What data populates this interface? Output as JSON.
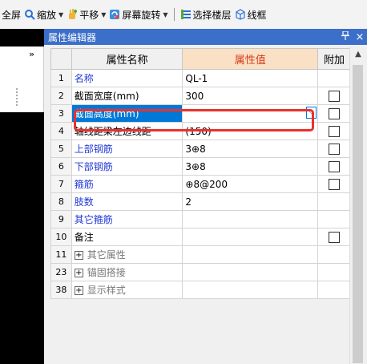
{
  "toolbar": {
    "full_screen": "全屏",
    "zoom": "缩放",
    "pan": "平移",
    "screen_rotate": "屏幕旋转",
    "select_floor": "选择楼层",
    "wireframe": "线框"
  },
  "left_panel": {
    "collapse_label": "»"
  },
  "editor": {
    "title": "属性编辑器",
    "pin_glyph": "ᵖ",
    "close_glyph": "×",
    "columns": {
      "name": "属性名称",
      "value": "属性值",
      "extra": "附加"
    },
    "rows": [
      {
        "num": "1",
        "name": "名称",
        "value": "QL-1"
      },
      {
        "num": "2",
        "name": "截面宽度(mm)",
        "value": "300"
      },
      {
        "num": "3",
        "name": "截面高度(mm)",
        "value": ""
      },
      {
        "num": "4",
        "name": "轴线距梁左边线距",
        "value": "(150)"
      },
      {
        "num": "5",
        "name": "上部钢筋",
        "value": "3⊕8"
      },
      {
        "num": "6",
        "name": "下部钢筋",
        "value": "3⊕8"
      },
      {
        "num": "7",
        "name": "箍筋",
        "value": "⊕8@200"
      },
      {
        "num": "8",
        "name": "肢数",
        "value": "2"
      },
      {
        "num": "9",
        "name": "其它箍筋",
        "value": ""
      },
      {
        "num": "10",
        "name": "备注",
        "value": ""
      },
      {
        "num": "11",
        "name": "其它属性",
        "value": ""
      },
      {
        "num": "23",
        "name": "锚固搭接",
        "value": ""
      },
      {
        "num": "38",
        "name": "显示样式",
        "value": ""
      }
    ],
    "expand_glyph": "+"
  },
  "scroll_up_glyph": "▲",
  "colors": {
    "title_bar": "#3b6fc9",
    "value_header_bg": "#fae1c5",
    "value_header_text": "#d63b1a",
    "link_blue": "#2239d6",
    "selection": "#0078d7",
    "highlight_border": "#e8322e"
  }
}
